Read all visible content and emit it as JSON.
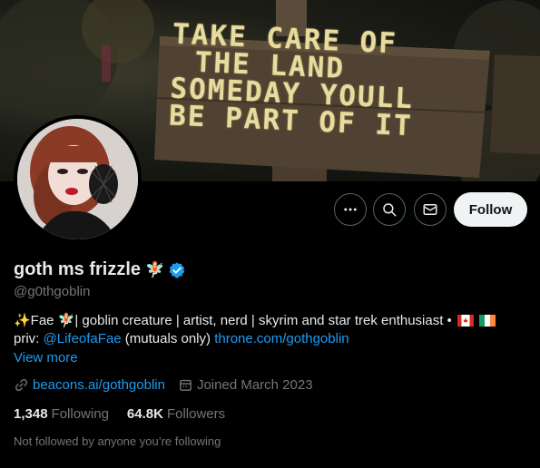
{
  "banner": {
    "sign_lines": [
      "TAKE CARE OF",
      "THE LAND",
      "SOMEDAY YOULL",
      "BE PART OF IT"
    ]
  },
  "avatar": {
    "icon": "profile-photo"
  },
  "actions": {
    "more_icon": "more-horizontal-icon",
    "search_icon": "search-icon",
    "message_icon": "envelope-icon",
    "follow_label": "Follow"
  },
  "profile": {
    "display_name": "goth ms frizzle",
    "name_emoji": "🧚🏻",
    "verified_icon": "verified-badge-icon",
    "handle": "@g0thgoblin",
    "bio_line1_prefix": "✨Fae 🧚🏻| goblin creature | artist, nerd | skyrim and star trek enthusiast •",
    "bio_line2_priv": "priv: ",
    "bio_line2_mention": "@LifeofaFae",
    "bio_line2_mid": " (mutuals only) ",
    "bio_line2_link": "throne.com/gothgoblin",
    "view_more": "View more",
    "website": "beacons.ai/gothgoblin",
    "joined": "Joined March 2023",
    "following_count": "1,348",
    "following_label": "Following",
    "followers_count": "64.8K",
    "followers_label": "Followers",
    "followed_by": "Not followed by anyone you’re following"
  },
  "colors": {
    "accent": "#1d9bf0",
    "muted": "#71767b",
    "text": "#e7e9ea",
    "verified": "#1d9bf0"
  }
}
